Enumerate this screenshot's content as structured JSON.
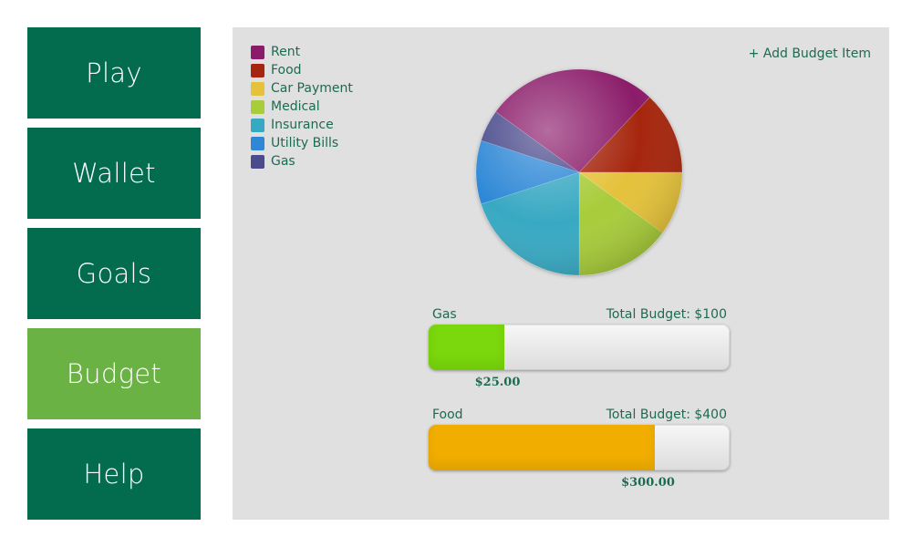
{
  "nav": {
    "items": [
      {
        "label": "Play",
        "active": false
      },
      {
        "label": "Wallet",
        "active": false
      },
      {
        "label": "Goals",
        "active": false
      },
      {
        "label": "Budget",
        "active": true
      },
      {
        "label": "Help",
        "active": false
      }
    ]
  },
  "budget": {
    "add_label": "+ Add Budget Item",
    "legend": [
      {
        "label": "Rent",
        "color": "#8b1a6b"
      },
      {
        "label": "Food",
        "color": "#a62510"
      },
      {
        "label": "Car Payment",
        "color": "#e5c23a"
      },
      {
        "label": "Medical",
        "color": "#a8cc3a"
      },
      {
        "label": "Insurance",
        "color": "#38a9c2"
      },
      {
        "label": "Utility Bills",
        "color": "#2f88d6"
      },
      {
        "label": "Gas",
        "color": "#4a4a8c"
      }
    ],
    "bars": [
      {
        "name": "Gas",
        "total_label": "Total Budget: $100",
        "total": 100,
        "spent": 25,
        "spent_label": "$25.00",
        "color": "#7ad80c"
      },
      {
        "name": "Food",
        "total_label": "Total Budget: $400",
        "total": 400,
        "spent": 300,
        "spent_label": "$300.00",
        "color": "#f2ae00"
      }
    ]
  },
  "chart_data": {
    "type": "pie",
    "series": [
      {
        "name": "Rent",
        "value": 27,
        "color": "#8b1a6b"
      },
      {
        "name": "Food",
        "value": 13,
        "color": "#a62510"
      },
      {
        "name": "Car Payment",
        "value": 10,
        "color": "#e5c23a"
      },
      {
        "name": "Medical",
        "value": 15,
        "color": "#a8cc3a"
      },
      {
        "name": "Insurance",
        "value": 20,
        "color": "#38a9c2"
      },
      {
        "name": "Utility Bills",
        "value": 10,
        "color": "#2f88d6"
      },
      {
        "name": "Gas",
        "value": 5,
        "color": "#4a4a8c"
      }
    ]
  }
}
